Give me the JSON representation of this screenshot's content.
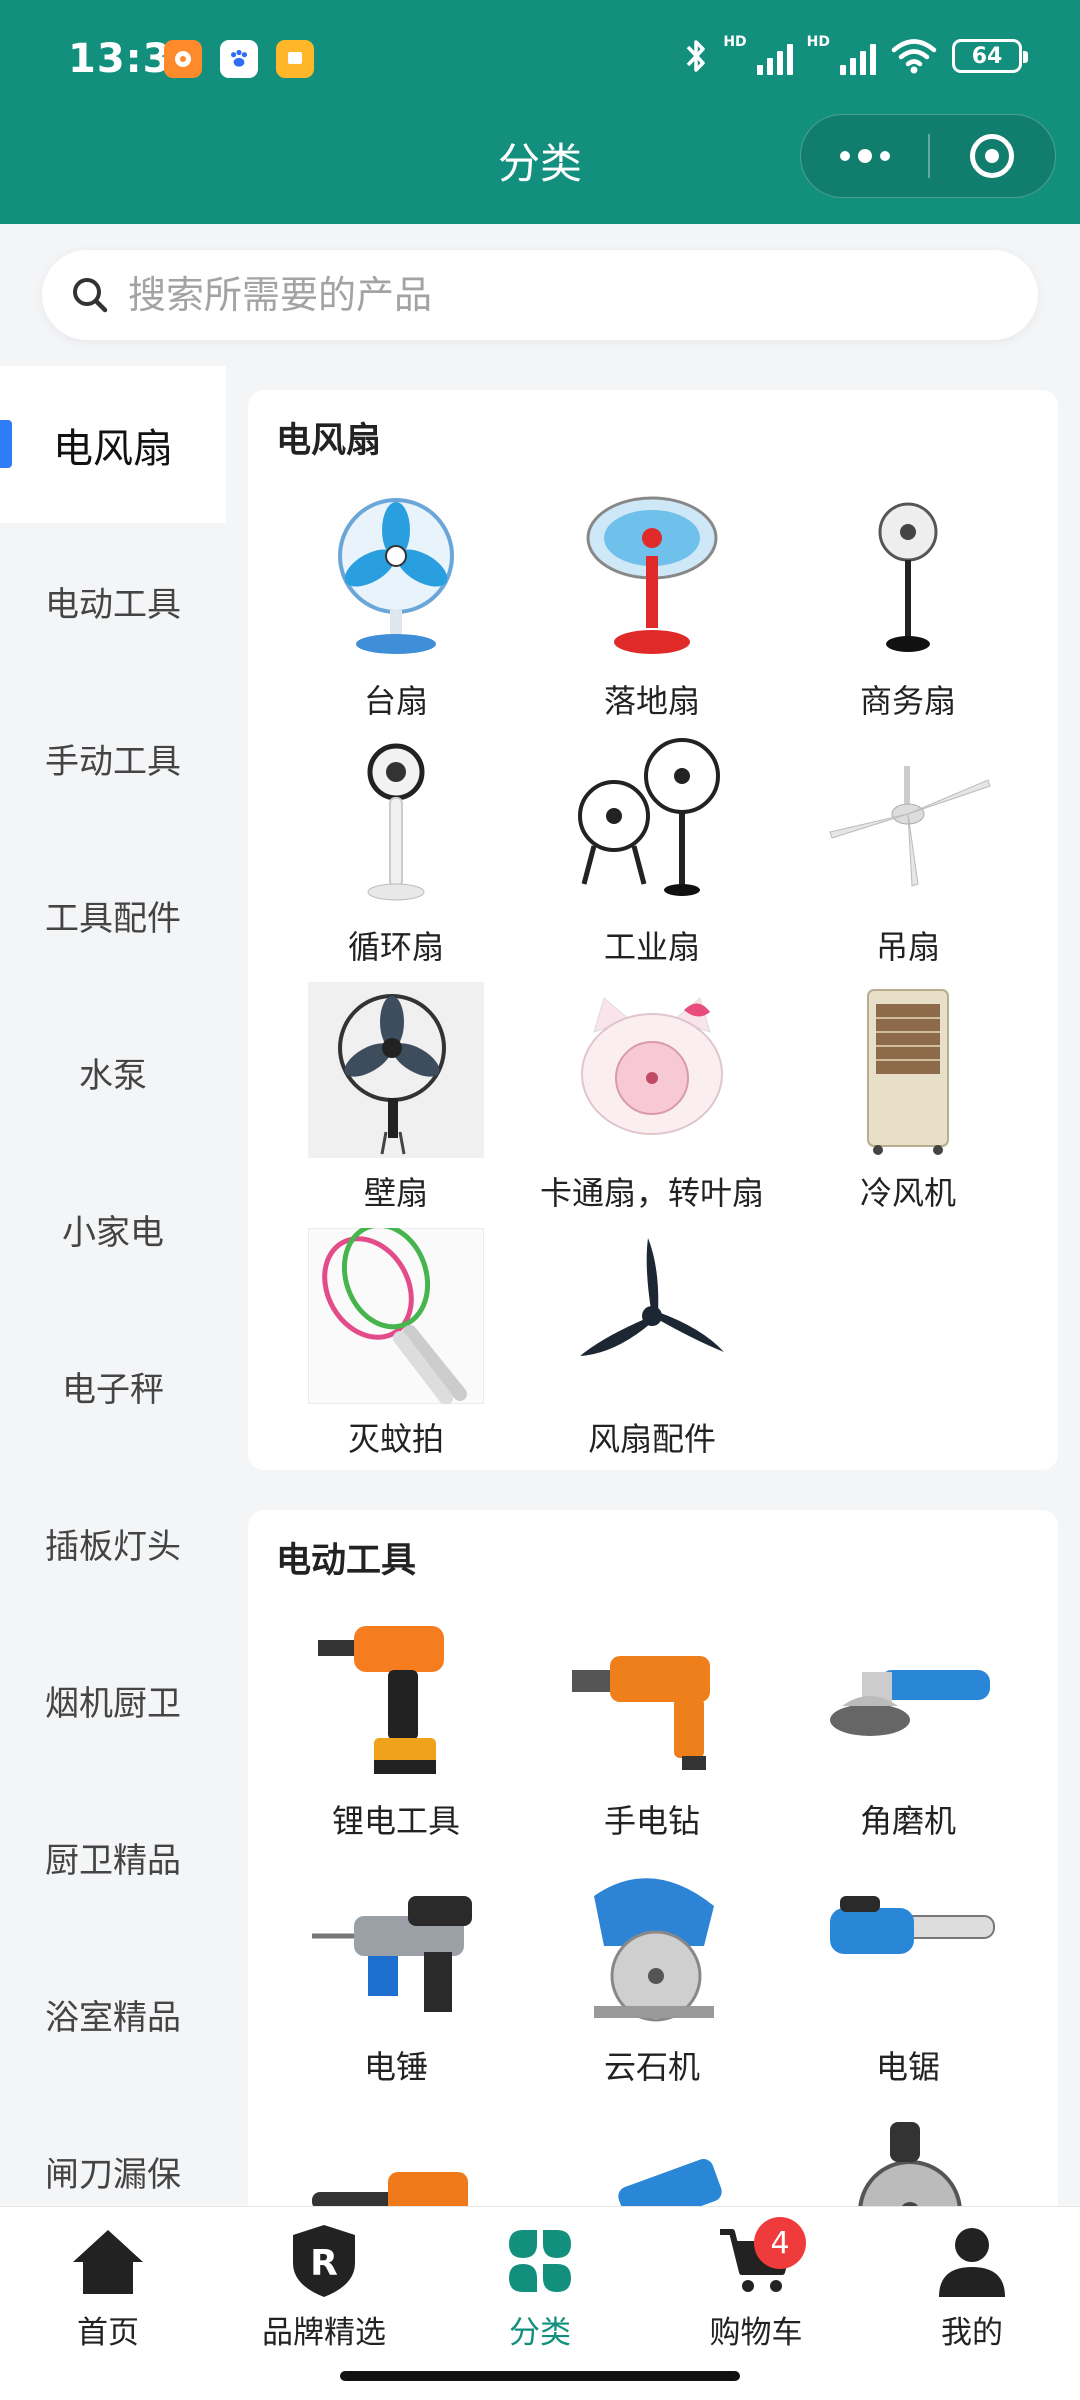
{
  "status_bar": {
    "time": "13:31",
    "battery": "64",
    "hd1": "HD",
    "hd2": "HD"
  },
  "header": {
    "title": "分类"
  },
  "search": {
    "placeholder": "搜索所需要的产品"
  },
  "sidebar": {
    "items": [
      {
        "label": "电风扇",
        "active": true
      },
      {
        "label": "电动工具"
      },
      {
        "label": "手动工具"
      },
      {
        "label": "工具配件"
      },
      {
        "label": "水泵"
      },
      {
        "label": "小家电"
      },
      {
        "label": "电子秤"
      },
      {
        "label": "插板灯头"
      },
      {
        "label": "烟机厨卫"
      },
      {
        "label": "厨卫精品"
      },
      {
        "label": "浴室精品"
      },
      {
        "label": "闸刀漏保"
      }
    ]
  },
  "sections": [
    {
      "title": "电风扇",
      "items": [
        {
          "label": "台扇",
          "icon": "desk-fan-icon"
        },
        {
          "label": "落地扇",
          "icon": "floor-fan-icon"
        },
        {
          "label": "商务扇",
          "icon": "business-fan-icon"
        },
        {
          "label": "循环扇",
          "icon": "circulation-fan-icon"
        },
        {
          "label": "工业扇",
          "icon": "industrial-fan-icon"
        },
        {
          "label": "吊扇",
          "icon": "ceiling-fan-icon"
        },
        {
          "label": "壁扇",
          "icon": "wall-fan-icon"
        },
        {
          "label": "卡通扇，转叶扇",
          "icon": "cartoon-fan-icon"
        },
        {
          "label": "冷风机",
          "icon": "air-cooler-icon"
        },
        {
          "label": "灭蚊拍",
          "icon": "mosquito-swatter-icon"
        },
        {
          "label": "风扇配件",
          "icon": "fan-blade-icon"
        }
      ]
    },
    {
      "title": "电动工具",
      "items": [
        {
          "label": "锂电工具",
          "icon": "cordless-drill-icon"
        },
        {
          "label": "手电钻",
          "icon": "electric-drill-icon"
        },
        {
          "label": "角磨机",
          "icon": "angle-grinder-icon"
        },
        {
          "label": "电锤",
          "icon": "rotary-hammer-icon"
        },
        {
          "label": "云石机",
          "icon": "marble-cutter-icon"
        },
        {
          "label": "电锯",
          "icon": "electric-chainsaw-icon"
        },
        {
          "label": "",
          "icon": "chainsaw-icon"
        },
        {
          "label": "",
          "icon": "demolition-hammer-icon"
        },
        {
          "label": "",
          "icon": "cut-off-saw-icon"
        }
      ]
    }
  ],
  "tabbar": {
    "items": [
      {
        "label": "首页",
        "icon": "home-icon"
      },
      {
        "label": "品牌精选",
        "icon": "brand-shield-icon"
      },
      {
        "label": "分类",
        "icon": "category-icon",
        "active": true
      },
      {
        "label": "购物车",
        "icon": "cart-icon",
        "badge": "4"
      },
      {
        "label": "我的",
        "icon": "user-icon"
      }
    ]
  },
  "colors": {
    "brand": "#138f7d",
    "active_indicator": "#2f7df6",
    "badge": "#ef3b3b"
  }
}
